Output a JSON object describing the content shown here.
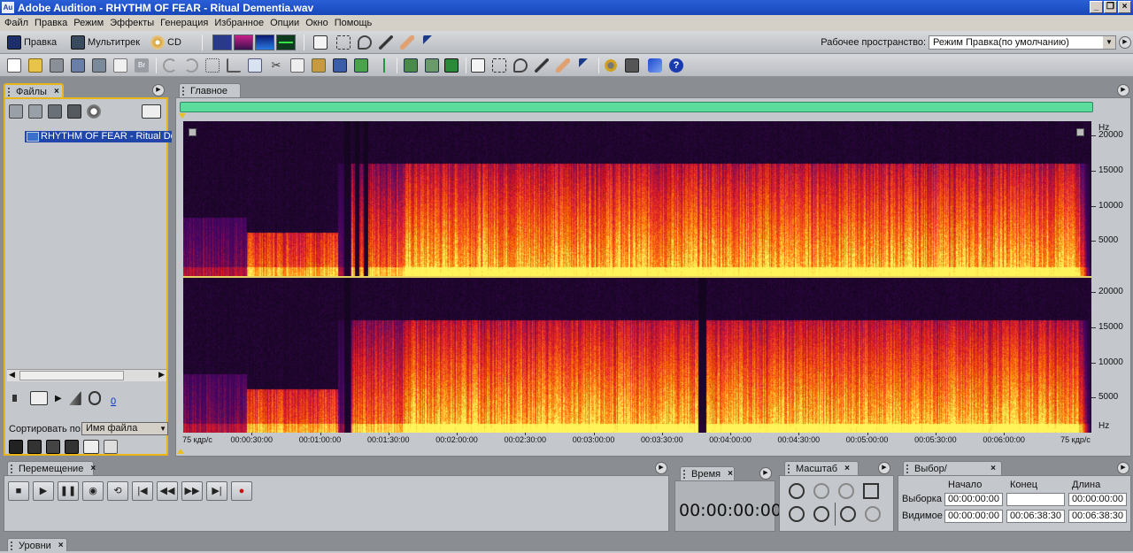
{
  "window": {
    "title": "Adobe Audition - RHYTHM OF FEAR - Ritual Dementia.wav",
    "app_icon_text": "Au",
    "controls": [
      "_",
      "❐",
      "×"
    ]
  },
  "menu": [
    "Файл",
    "Правка",
    "Режим",
    "Эффекты",
    "Генерация",
    "Избранное",
    "Опции",
    "Окно",
    "Помощь"
  ],
  "toolbar1": {
    "edit_label": "Правка",
    "multitrack_label": "Мультитрек",
    "cd_label": "CD",
    "workspace_label": "Рабочее пространство:",
    "workspace_value": "Режим Правка(по умолчанию)"
  },
  "files_panel": {
    "tab": "Файлы",
    "file_name": "RHYTHM OF FEAR - Ritual Dementia.wav",
    "volume_value": "0",
    "sort_label": "Сортировать по:",
    "sort_value": "Имя файла"
  },
  "main_panel": {
    "tab": "Главное",
    "freq_unit": "Hz",
    "freq_labels": [
      "20000",
      "15000",
      "10000",
      "5000"
    ],
    "time_left_label": "75 кдр/с",
    "time_right_label": "75 кдр/с",
    "time_labels": [
      "00:00:30:00",
      "00:01:00:00",
      "00:01:30:00",
      "00:02:00:00",
      "00:02:30:00",
      "00:03:00:00",
      "00:03:30:00",
      "00:04:00:00",
      "00:04:30:00",
      "00:05:00:00",
      "00:05:30:00",
      "00:06:00:00"
    ]
  },
  "transport": {
    "tab": "Перемещение"
  },
  "time_panel": {
    "tab": "Время",
    "display": "00:00:00:00"
  },
  "zoom_panel": {
    "tab": "Масштаб"
  },
  "selection_panel": {
    "tab": "Выбор/Видимое",
    "col_start": "Начало",
    "col_end": "Конец",
    "col_length": "Длина",
    "row_selection": "Выборка",
    "row_view": "Видимое",
    "selection": {
      "start": "00:00:00:00",
      "end": "",
      "length": "00:00:00:00"
    },
    "view": {
      "start": "00:00:00:00",
      "end": "00:06:38:30",
      "length": "00:06:38:30"
    }
  },
  "levels_panel": {
    "tab": "Уровни"
  },
  "colors": {
    "accent_panel": "#e8b418",
    "overview": "#5cdc9d",
    "title_bar": "#1f4fc8"
  }
}
